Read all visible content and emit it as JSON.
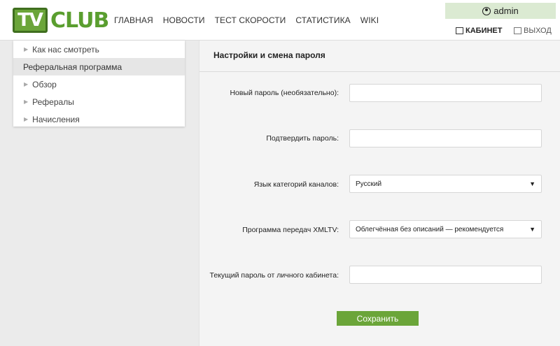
{
  "logo": {
    "tv": "TV",
    "club": "CLUB"
  },
  "nav": [
    "ГЛАВНАЯ",
    "НОВОСТИ",
    "ТЕСТ СКОРОСТИ",
    "СТАТИСТИКА",
    "WIKI"
  ],
  "user": {
    "name": "admin",
    "cabinet": "КАБИНЕТ",
    "logout": "ВЫХОД"
  },
  "sidebar": {
    "items": [
      {
        "label": "Как нас смотреть",
        "type": "sub"
      },
      {
        "label": "Реферальная программа",
        "type": "section"
      },
      {
        "label": "Обзор",
        "type": "sub"
      },
      {
        "label": "Рефералы",
        "type": "sub"
      },
      {
        "label": "Начисления",
        "type": "sub"
      }
    ]
  },
  "form": {
    "title": "Настройки и смена пароля",
    "new_password_label": "Новый пароль (необязательно):",
    "new_password_value": "",
    "confirm_password_label": "Подтвердить пароль:",
    "confirm_password_value": "",
    "language_label": "Язык категорий каналов:",
    "language_value": "Русский",
    "xmltv_label": "Программа передач XMLTV:",
    "xmltv_value": "Облегчённая без описаний — рекомендуется",
    "current_password_label": "Текущий пароль от личного кабинета:",
    "current_password_value": "",
    "save_label": "Сохранить"
  },
  "colors": {
    "accent": "#6ba539",
    "user_box": "#dbead2"
  }
}
